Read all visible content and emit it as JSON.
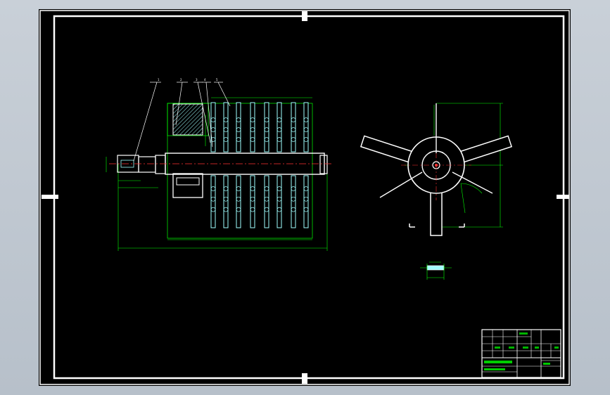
{
  "balloons": [
    {
      "label": "1"
    },
    {
      "label": "2"
    },
    {
      "label": "3"
    },
    {
      "label": "4"
    },
    {
      "label": "5"
    }
  ],
  "colors": {
    "background": "#000000",
    "frame": "#ffffff",
    "dimension": "#00ff00",
    "paddle": "#a0ffff",
    "centerline": "#ff3333",
    "title_block_text": "#00ff00"
  }
}
